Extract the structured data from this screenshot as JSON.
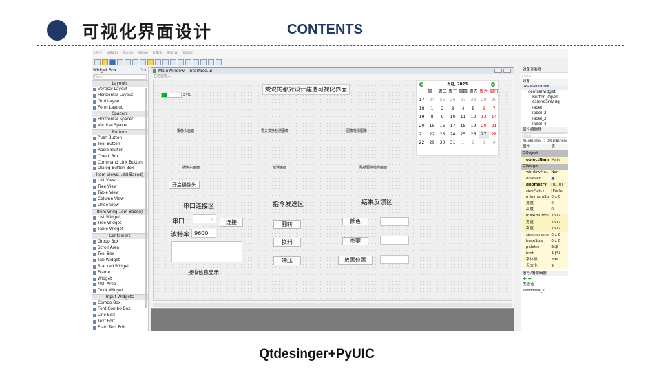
{
  "slide": {
    "title": "可视化界面设计",
    "contents": "CONTENTS",
    "caption": "Qtdesinger+PyUIC"
  },
  "menubar": [
    "文件(F)",
    "编辑(E)",
    "窗体(O)",
    "视图(V)",
    "设置(S)",
    "窗口(W)",
    "帮助(H)"
  ],
  "widget_box": {
    "title": "Widget Box",
    "filter_placeholder": "Filter",
    "items": [
      {
        "label": "Layouts",
        "cat": true
      },
      {
        "label": "Vertical Layout"
      },
      {
        "label": "Horizontal Layout"
      },
      {
        "label": "Grid Layout"
      },
      {
        "label": "Form Layout"
      },
      {
        "label": "Spacers",
        "cat": true
      },
      {
        "label": "Horizontal Spacer"
      },
      {
        "label": "Vertical Spacer"
      },
      {
        "label": "Buttons",
        "cat": true
      },
      {
        "label": "Push Button"
      },
      {
        "label": "Tool Button"
      },
      {
        "label": "Radio Button"
      },
      {
        "label": "Check Box"
      },
      {
        "label": "Command Link Button"
      },
      {
        "label": "Dialog Button Box"
      },
      {
        "label": "Item Views...del-Based)",
        "cat": true
      },
      {
        "label": "List View"
      },
      {
        "label": "Tree View"
      },
      {
        "label": "Table View"
      },
      {
        "label": "Column View"
      },
      {
        "label": "Undo View"
      },
      {
        "label": "Item Widg...em-Based)",
        "cat": true
      },
      {
        "label": "List Widget"
      },
      {
        "label": "Tree Widget"
      },
      {
        "label": "Table Widget"
      },
      {
        "label": "Containers",
        "cat": true
      },
      {
        "label": "Group Box"
      },
      {
        "label": "Scroll Area"
      },
      {
        "label": "Tool Box"
      },
      {
        "label": "Tab Widget"
      },
      {
        "label": "Stacked Widget"
      },
      {
        "label": "Frame"
      },
      {
        "label": "Widget"
      },
      {
        "label": "MDI Area"
      },
      {
        "label": "Dock Widget"
      },
      {
        "label": "Input Widgets",
        "cat": true
      },
      {
        "label": "Combo Box"
      },
      {
        "label": "Font Combo Box"
      },
      {
        "label": "Line Edit"
      },
      {
        "label": "Text Edit"
      },
      {
        "label": "Plain Text Edit"
      }
    ]
  },
  "main_window": {
    "title": "MainWindow - interface.ui",
    "type_here": "在这里输入",
    "heading": "党说的都对设计建造可视化界面",
    "progress_percent": 24,
    "progress_label": "24%",
    "img_labels": [
      "摄像头画面",
      "霍夫变换检测图像",
      "图像检测图像",
      "摄像头画面",
      "检测画面",
      "贴纸图像检测画面"
    ],
    "open_camera": "开启摄像头",
    "serial_title": "串口连接区",
    "port_label": "串口",
    "connect": "连接",
    "baud_label": "波特率",
    "baud_value": "9600",
    "receive_label": "接收信息显示",
    "cmd_title": "指令发送区",
    "cmd_buttons": [
      "翻转",
      "换料",
      "冲压"
    ],
    "result_title": "结果反馈区",
    "result_labels": [
      "颜色",
      "图案",
      "放置位置"
    ]
  },
  "calendar": {
    "month": "五月,",
    "year": "2023",
    "weekdays": [
      "周一",
      "周二",
      "周三",
      "周四",
      "周五",
      "周六",
      "周日"
    ],
    "weeks": [
      {
        "wk": "17",
        "days": [
          "24",
          "25",
          "26",
          "27",
          "28",
          "29",
          "30"
        ]
      },
      {
        "wk": "18",
        "days": [
          "1",
          "2",
          "3",
          "4",
          "5",
          "6",
          "7"
        ]
      },
      {
        "wk": "19",
        "days": [
          "8",
          "9",
          "10",
          "11",
          "12",
          "13",
          "14"
        ]
      },
      {
        "wk": "20",
        "days": [
          "15",
          "16",
          "17",
          "18",
          "19",
          "20",
          "21"
        ]
      },
      {
        "wk": "21",
        "days": [
          "22",
          "23",
          "24",
          "25",
          "26",
          "27",
          "28"
        ]
      },
      {
        "wk": "22",
        "days": [
          "29",
          "30",
          "31",
          "1",
          "2",
          "3",
          "4"
        ]
      }
    ]
  },
  "object_inspector": {
    "title": "对象查看器",
    "filter_placeholder": "Filter",
    "col_object": "对象",
    "tree": [
      "MainWindow",
      "centralwidget",
      "Button_Open",
      "calendarWidg",
      "label",
      "label_2",
      "label_3",
      "label_4"
    ]
  },
  "property_editor": {
    "title": "属性编辑器",
    "filter_placeholder": "Filter",
    "path": "MainWindow : QMainWindow",
    "col_prop": "属性",
    "col_value": "值",
    "rows": [
      {
        "k": "QObject",
        "v": "",
        "grp": true
      },
      {
        "k": "objectName",
        "v": "Main",
        "style": "y"
      },
      {
        "k": "QWidget",
        "v": "",
        "grp": true
      },
      {
        "k": "windowMo...",
        "v": "Non",
        "style": "y2"
      },
      {
        "k": "enabled",
        "v": "■",
        "style": "y2"
      },
      {
        "k": "geometry",
        "v": "[(0, 0)",
        "style": "y"
      },
      {
        "k": "sizePolicy",
        "v": "[Prefe",
        "style": "y2"
      },
      {
        "k": "minimumSize",
        "v": "0 x 0",
        "style": "y2"
      },
      {
        "k": "宽度",
        "v": "0",
        "style": "y2"
      },
      {
        "k": "高度",
        "v": "0",
        "style": "y2"
      },
      {
        "k": "maximumSi...",
        "v": "1677",
        "style": "y"
      },
      {
        "k": "宽度",
        "v": "1677",
        "style": "y"
      },
      {
        "k": "高度",
        "v": "1677",
        "style": "y"
      },
      {
        "k": "sizeIncreme...",
        "v": "0 x 0",
        "style": "y2"
      },
      {
        "k": "baseSize",
        "v": "0 x 0",
        "style": "y2"
      },
      {
        "k": "palette",
        "v": "继承",
        "style": "y2"
      },
      {
        "k": "font",
        "v": "A [Si",
        "style": "y2"
      },
      {
        "k": "字体族",
        "v": "3ds",
        "style": "y2"
      },
      {
        "k": "点大小",
        "v": "9",
        "style": "y2"
      }
    ]
  },
  "signal_editor": {
    "title": "信号/槽编辑器",
    "col_sender": "发送者",
    "row1": "senddata_2"
  }
}
